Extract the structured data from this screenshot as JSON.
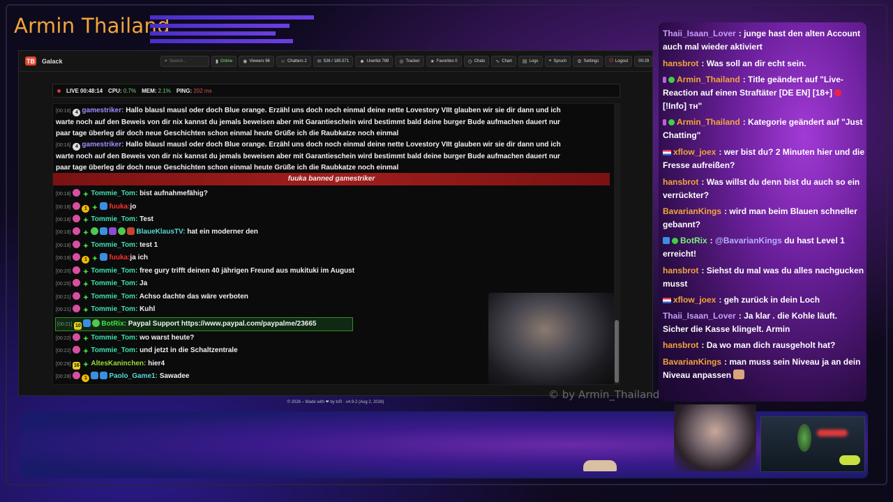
{
  "overlay": {
    "channel_title": "Armin Thailand",
    "watermark": "© by Armin_Thailand"
  },
  "app": {
    "logo_text": "TB",
    "name": "Galack",
    "toolbar": {
      "search_placeholder": "Search...",
      "online": "Online",
      "viewers": "Viewers 96",
      "chatters": "Chatters 2",
      "messages": "526 / 185.571",
      "userlist": "Userlist 789",
      "tracker": "Tracker",
      "favorites": "Favorites 0",
      "chats": "Chats",
      "chart": "Chart",
      "logs": "Logs",
      "spruch": "Spruch",
      "settings": "Settings",
      "logout": "Logout",
      "clock": "00:29"
    },
    "status": {
      "live_label": "LIVE",
      "live_time": "00:48:14",
      "cpu_label": "CPU:",
      "cpu_value": "0.7%",
      "mem_label": "MEM:",
      "mem_value": "2.1%",
      "ping_label": "PING:",
      "ping_value": "202 ms"
    },
    "chat": {
      "long_msgs": [
        {
          "time": "[00:16]",
          "user": "gamestriker:",
          "line1": "Hallo blausl mausl oder doch Blue orange. Erzähl uns doch noch einmal deine nette Lovestory VIIt glauben wir sie dir dann und ich",
          "line2": "warte noch auf den Beweis von dir nix kannst du jemals beweisen aber mit Garantieschein wird bestimmt bald deine burger Bude aufmachen dauert nur",
          "line3": "paar tage überleg dir doch neue Geschichten schon einmal heute Grüße ich die Raubkatze noch einmal"
        },
        {
          "time": "[00:16]",
          "user": "gamestriker:",
          "line1": "Hallo blausl mausl oder doch Blue orange. Erzähl uns doch noch einmal deine nette Lovestory VIIt glauben wir sie dir dann und ich",
          "line2": "warte noch auf den Beweis von dir nix kannst du jemals beweisen aber mit Garantieschein wird bestimmt bald deine burger Bude aufmachen dauert nur",
          "line3": "paar tage überleg dir doch neue Geschichten schon einmal heute Grüße ich die Raubkatze noch einmal"
        }
      ],
      "ban_notice": "fuuka banned gamestriker",
      "messages": [
        {
          "time": "[00:18]",
          "user": "Tommie_Tom:",
          "text": "bist aufnahmefähig?"
        },
        {
          "time": "[00:18]",
          "user": "fuuka:",
          "text": "jo"
        },
        {
          "time": "[00:18]",
          "user": "Tommie_Tom:",
          "text": "Test"
        },
        {
          "time": "[00:18]",
          "user": "BlaueKlausTV:",
          "text": "hat ein moderner den"
        },
        {
          "time": "[00:18]",
          "user": "Tommie_Tom:",
          "text": "test 1"
        },
        {
          "time": "[00:19]",
          "user": "fuuka:",
          "text": "ja ich"
        },
        {
          "time": "[00:20]",
          "user": "Tommie_Tom:",
          "text": "free gury trifft deinen 40 jährigen Freund aus mukituki im August"
        },
        {
          "time": "[00:20]",
          "user": "Tommie_Tom:",
          "text": "Ja"
        },
        {
          "time": "[00:21]",
          "user": "Tommie_Tom:",
          "text": "Achso dachte das wäre verboten"
        },
        {
          "time": "[00:21]",
          "user": "Tommie_Tom:",
          "text": "Kuhl"
        },
        {
          "time": "[00:21]",
          "user": "BotRix:",
          "text": "Paypal Support https://www.paypal.com/paypalme/23665",
          "badge_num": "10"
        },
        {
          "time": "[00:22]",
          "user": "Tommie_Tom:",
          "text": "wo warst heute?"
        },
        {
          "time": "[00:22]",
          "user": "Tommie_Tom:",
          "text": "und jetzt in die Schaltzentrale"
        },
        {
          "time": "[00:28]",
          "user": "AltesKaninchen:",
          "text": "hier4",
          "badge_num": "16"
        },
        {
          "time": "[00:28]",
          "user": "Paolo_Game1:",
          "text": "Sawadee"
        }
      ]
    },
    "footer": "© 2026 – Made with ❤ by tcR · v4.9-2 (Aug 2, 2026)"
  },
  "side_chat": [
    {
      "user": "Thaii_Isaan_Lover",
      "text": "junge hast den alten Account auch mal wieder aktiviert"
    },
    {
      "user": "hansbrot",
      "text": "Was soll an dir echt sein."
    },
    {
      "user": "Armin_Thailand",
      "text": "Title geändert auf \"Live-Reaction auf einen Straftäter [DE EN] [18+]"
    },
    {
      "user": "Armin_Thailand",
      "text": "[!Info] ᴛʜ\""
    },
    {
      "user": "Armin_Thailand",
      "text": "Kategorie geändert auf \"Just Chatting\""
    },
    {
      "user": "xflow_joex",
      "text": "wer bist du? 2 Minuten hier und die Fresse aufreißen?"
    },
    {
      "user": "hansbrot",
      "text": "Was willst du denn bist du auch so ein verrückter?"
    },
    {
      "user": "BavarianKings",
      "text": "wird man beim Blauen schneller gebannt?"
    },
    {
      "user": "BotRix",
      "mention": "@BavarianKings",
      "text": "du hast Level 1 erreicht!"
    },
    {
      "user": "hansbrot",
      "text": "Siehst du mal was du alles nachgucken musst"
    },
    {
      "user": "xflow_joex",
      "text": "geh zurück in dein Loch"
    },
    {
      "user": "Thaii_Isaan_Lover",
      "text": "Ja klar . die Kohle läuft. Sicher die Kasse klingelt. Armin"
    },
    {
      "user": "hansbrot",
      "text": "Da wo man dich rausgeholt hat?"
    },
    {
      "user": "BavarianKings",
      "text": "man muss sein Niveau ja an dein Niveau anpassen"
    }
  ]
}
